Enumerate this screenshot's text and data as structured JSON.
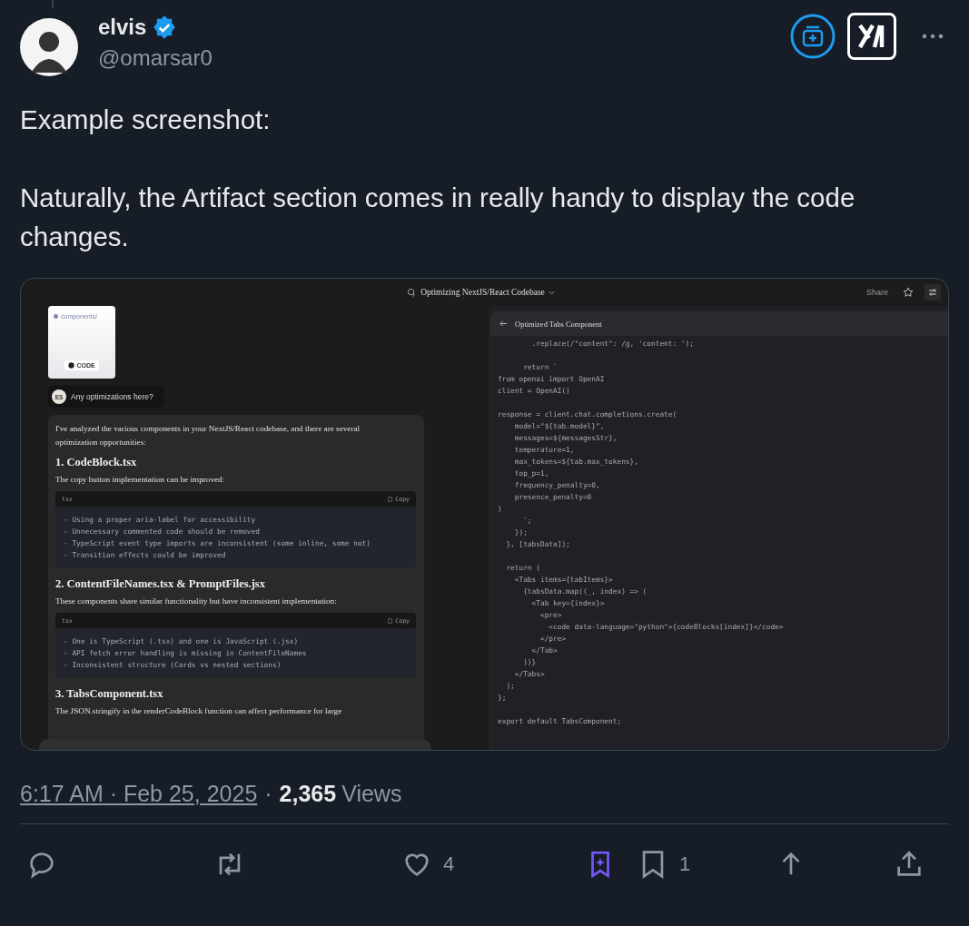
{
  "author": {
    "name": "elvis",
    "handle": "@omarsar0"
  },
  "tweet": {
    "paragraphs": [
      "Example screenshot:",
      "Naturally, the Artifact section comes in really handy to display the code changes."
    ]
  },
  "embed": {
    "title": "Optimizing NextJS/React Codebase",
    "share": "Share",
    "attachment": {
      "path": "components/",
      "badge": "CODE"
    },
    "user_message": {
      "initials": "ES",
      "text": "Any optimizations here?"
    },
    "response": [
      {
        "kind": "text",
        "text": "I've analyzed the various components in your NextJS/React codebase, and there are several optimization opportunities:"
      },
      {
        "kind": "heading",
        "text": "1. CodeBlock.tsx"
      },
      {
        "kind": "text",
        "text": "The copy button implementation can be improved:"
      },
      {
        "kind": "code",
        "language": "tsx",
        "copy": "Copy",
        "code": "- Using a proper aria-label for accessibility\n- Unnecessary commented code should be removed\n- TypeScript event type imports are inconsistent (some inline, some not)\n- Transition effects could be improved"
      },
      {
        "kind": "heading",
        "text": "2. ContentFileNames.tsx & PromptFiles.jsx"
      },
      {
        "kind": "text",
        "text": "These components share similar functionality but have inconsistent implementation:"
      },
      {
        "kind": "code",
        "language": "tsx",
        "copy": "Copy",
        "code": "- One is TypeScript (.tsx) and one is JavaScript (.jsx)\n- API fetch error handling is missing in ContentFileNames\n- Inconsistent structure (Cards vs nested sections)"
      },
      {
        "kind": "heading",
        "text": "3. TabsComponent.tsx"
      },
      {
        "kind": "text",
        "text": "The JSON.stringify in the renderCodeBlock function can affect performance for large"
      }
    ],
    "artifact": {
      "title": "Optimized Tabs Component",
      "code": "        .replace(/\"content\": /g, 'content: ');\n\n      return `\nfrom openai import OpenAI\nclient = OpenAI()\n\nresponse = client.chat.completions.create(\n    model=\"${tab.model}\",\n    messages=${messagesStr},\n    temperature=1,\n    max_tokens=${tab.max_tokens},\n    top_p=1,\n    frequency_penalty=0,\n    presence_penalty=0\n)\n      `;\n    });\n  }, [tabsData]);\n\n  return (\n    <Tabs items={tabItems}>\n      {tabsData.map((_, index) => (\n        <Tab key={index}>\n          <pre>\n            <code data-language=\"python\">{codeBlocks[index]}</code>\n          </pre>\n        </Tab>\n      ))}\n    </Tabs>\n  );\n};\n\nexport default TabsComponent;"
    }
  },
  "meta": {
    "time": "6:17 AM · Feb 25, 2025",
    "separator": "·",
    "views": "2,365",
    "views_label": "Views"
  },
  "actions": [
    {
      "kind": "reply"
    },
    {
      "kind": "repost"
    },
    {
      "kind": "like",
      "count": "4"
    },
    {
      "kind": "grok"
    },
    {
      "kind": "bookmark",
      "count": "1"
    },
    {
      "kind": "upload"
    },
    {
      "kind": "share"
    }
  ]
}
